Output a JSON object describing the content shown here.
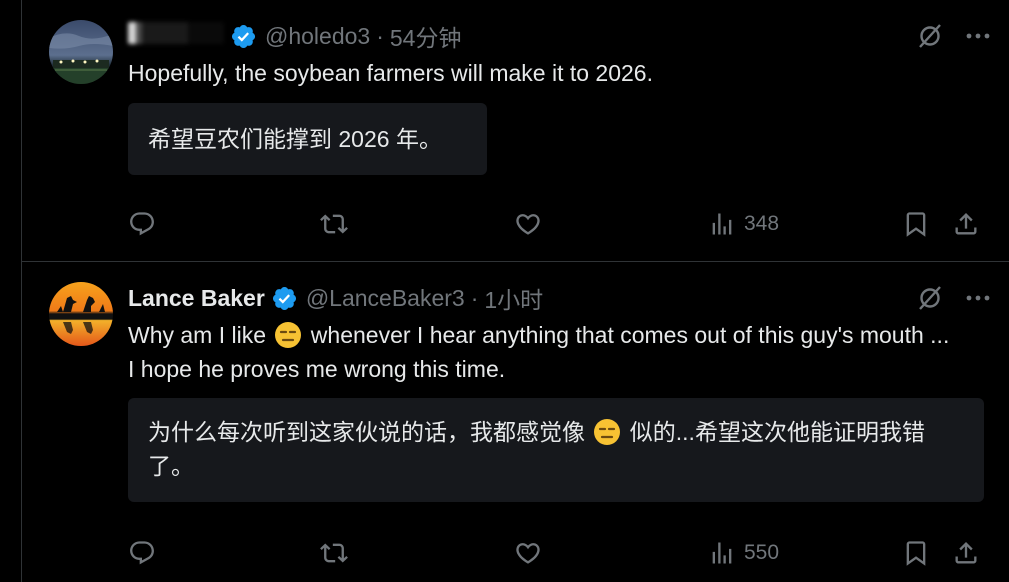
{
  "tweets": [
    {
      "display_name": "",
      "handle": "@holedo3",
      "separator": "·",
      "time": "54分钟",
      "text": "Hopefully, the soybean farmers will make it to 2026.",
      "translation": "希望豆农们能撑到 2026 年。",
      "views": "348",
      "avatar": "night-stadium-photo"
    },
    {
      "display_name": "Lance Baker",
      "handle": "@LanceBaker3",
      "separator": "·",
      "time": "1小时",
      "text_before_emoji": "Why am I like ",
      "text_after_emoji": " whenever I hear anything that comes out of this guy's mouth ... I hope he proves me wrong this time.",
      "translation_before_emoji": "为什么每次听到这家伙说的话，我都感觉像 ",
      "translation_after_emoji": " 似的...希望这次他能证明我错了。",
      "emoji": "expressionless-face",
      "views": "550",
      "avatar": "kangaroo-sunset-logo"
    }
  ],
  "colors": {
    "background": "#000000",
    "text": "#e7e9ea",
    "muted": "#71767b",
    "translation_bg": "#16181c",
    "verified": "#1d9bf0",
    "divider": "#2f3336"
  },
  "icons": {
    "reply": "reply-icon",
    "retweet": "retweet-icon",
    "like": "heart-icon",
    "views": "views-chart-icon",
    "bookmark": "bookmark-icon",
    "share": "share-icon",
    "grok": "grok-icon",
    "more": "more-icon",
    "verified": "verified-badge-icon"
  }
}
